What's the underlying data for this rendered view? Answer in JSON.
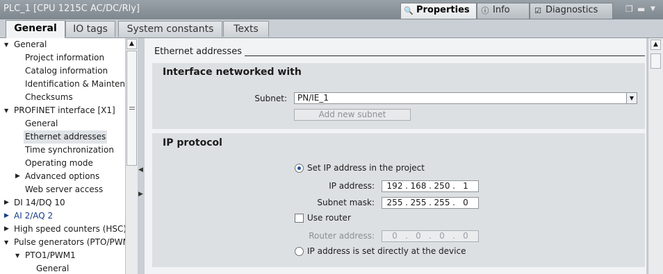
{
  "title_bar": {
    "title": "PLC_1 [CPU 1215C AC/DC/Rly]",
    "tabs": [
      {
        "label": "Properties",
        "icon": "properties-icon"
      },
      {
        "label": "Info",
        "icon": "info-icon"
      },
      {
        "label": "Diagnostics",
        "icon": "diagnostics-icon"
      }
    ]
  },
  "tabs": [
    "General",
    "IO tags",
    "System constants",
    "Texts"
  ],
  "tree": {
    "items": [
      {
        "label": "General"
      },
      {
        "label": "Project information"
      },
      {
        "label": "Catalog information"
      },
      {
        "label": "Identification & Mainten..."
      },
      {
        "label": "Checksums"
      },
      {
        "label": "PROFINET interface [X1]"
      },
      {
        "label": "General"
      },
      {
        "label": "Ethernet addresses"
      },
      {
        "label": "Time synchronization"
      },
      {
        "label": "Operating mode"
      },
      {
        "label": "Advanced options"
      },
      {
        "label": "Web server access"
      },
      {
        "label": "DI 14/DQ 10"
      },
      {
        "label": "AI 2/AQ 2"
      },
      {
        "label": "High speed counters (HSC)"
      },
      {
        "label": "Pulse generators (PTO/PWM)"
      },
      {
        "label": "PTO1/PWM1"
      },
      {
        "label": "General"
      }
    ]
  },
  "content": {
    "section_heading": "Ethernet addresses",
    "interface": {
      "title": "Interface networked with",
      "subnet_label": "Subnet:",
      "subnet_value": "PN/IE_1",
      "add_subnet_label": "Add new subnet"
    },
    "ip_protocol": {
      "title": "IP protocol",
      "set_ip_label": "Set IP address in the project",
      "ip_label": "IP address:",
      "ip": [
        "192",
        "168",
        "250",
        "1"
      ],
      "mask_label": "Subnet mask:",
      "mask": [
        "255",
        "255",
        "255",
        "0"
      ],
      "use_router_label": "Use router",
      "router_label": "Router address:",
      "router": [
        "0",
        "0",
        "0",
        "0"
      ],
      "device_ip_label": "IP address is set directly at the device"
    }
  }
}
